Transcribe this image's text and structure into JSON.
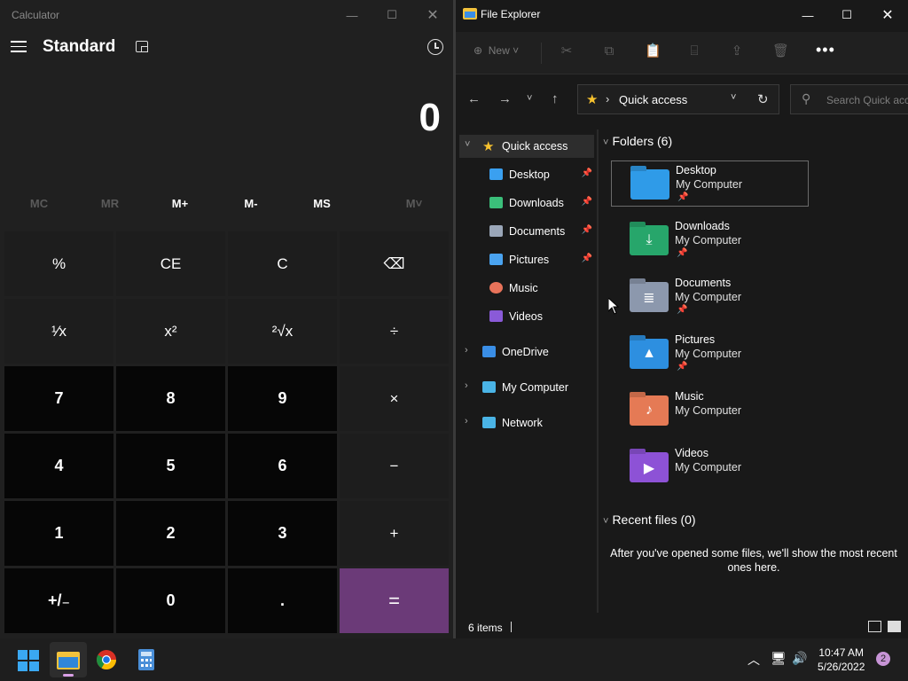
{
  "calculator": {
    "title": "Calculator",
    "mode": "Standard",
    "display": "0",
    "memory": [
      "MC",
      "MR",
      "M+",
      "M-",
      "MS",
      "M˅"
    ],
    "keys": [
      [
        "%",
        "CE",
        "C",
        "⌫"
      ],
      [
        "¹⁄x",
        "x²",
        "²√x",
        "÷"
      ],
      [
        "7",
        "8",
        "9",
        "×"
      ],
      [
        "4",
        "5",
        "6",
        "−"
      ],
      [
        "1",
        "2",
        "3",
        "+"
      ],
      [
        "+/₋",
        "0",
        ".",
        "="
      ]
    ]
  },
  "explorer": {
    "title": "File Explorer",
    "ribbon": {
      "new_label": "New"
    },
    "address": "Quick access",
    "search_placeholder": "Search Quick access",
    "sidebar": [
      {
        "label": "Quick access",
        "icon": "star-icon",
        "color": "#f7c22e",
        "expandable": true,
        "expanded": true
      },
      {
        "label": "Desktop",
        "icon": "desktop-icon",
        "color": "#3aa0f0",
        "pinned": true
      },
      {
        "label": "Downloads",
        "icon": "download-icon",
        "color": "#3bbf7a",
        "pinned": true
      },
      {
        "label": "Documents",
        "icon": "documents-icon",
        "color": "#9aa6b8",
        "pinned": true
      },
      {
        "label": "Pictures",
        "icon": "pictures-icon",
        "color": "#4aa3f0",
        "pinned": true
      },
      {
        "label": "Music",
        "icon": "music-icon",
        "color": "#e8735a"
      },
      {
        "label": "Videos",
        "icon": "videos-icon",
        "color": "#8a5ad8"
      },
      {
        "label": "OneDrive",
        "icon": "onedrive-icon",
        "color": "#3a8ee6",
        "expandable": true
      },
      {
        "label": "My Computer",
        "icon": "computer-icon",
        "color": "#4ab4e6",
        "expandable": true
      },
      {
        "label": "Network",
        "icon": "network-icon",
        "color": "#4ab4e6",
        "expandable": true
      }
    ],
    "folders_heading": "Folders (6)",
    "folders": [
      {
        "name": "Desktop",
        "location": "My Computer",
        "pinned": true,
        "color": "#2f9be8",
        "glyph": ""
      },
      {
        "name": "Downloads",
        "location": "My Computer",
        "pinned": true,
        "color": "#27a66b",
        "glyph": "⤓"
      },
      {
        "name": "Documents",
        "location": "My Computer",
        "pinned": true,
        "color": "#8c98ad",
        "glyph": "≣"
      },
      {
        "name": "Pictures",
        "location": "My Computer",
        "pinned": true,
        "color": "#2d8fe0",
        "glyph": "▲"
      },
      {
        "name": "Music",
        "location": "My Computer",
        "pinned": false,
        "color": "#e57a55",
        "glyph": "♪"
      },
      {
        "name": "Videos",
        "location": "My Computer",
        "pinned": false,
        "color": "#8d52d6",
        "glyph": "▶"
      }
    ],
    "recent_heading": "Recent files (0)",
    "recent_empty": "After you've opened some files, we'll show the most recent ones here.",
    "status_count": "6 items"
  },
  "taskbar": {
    "time": "10:47 AM",
    "date": "5/26/2022",
    "notifications": "2"
  }
}
